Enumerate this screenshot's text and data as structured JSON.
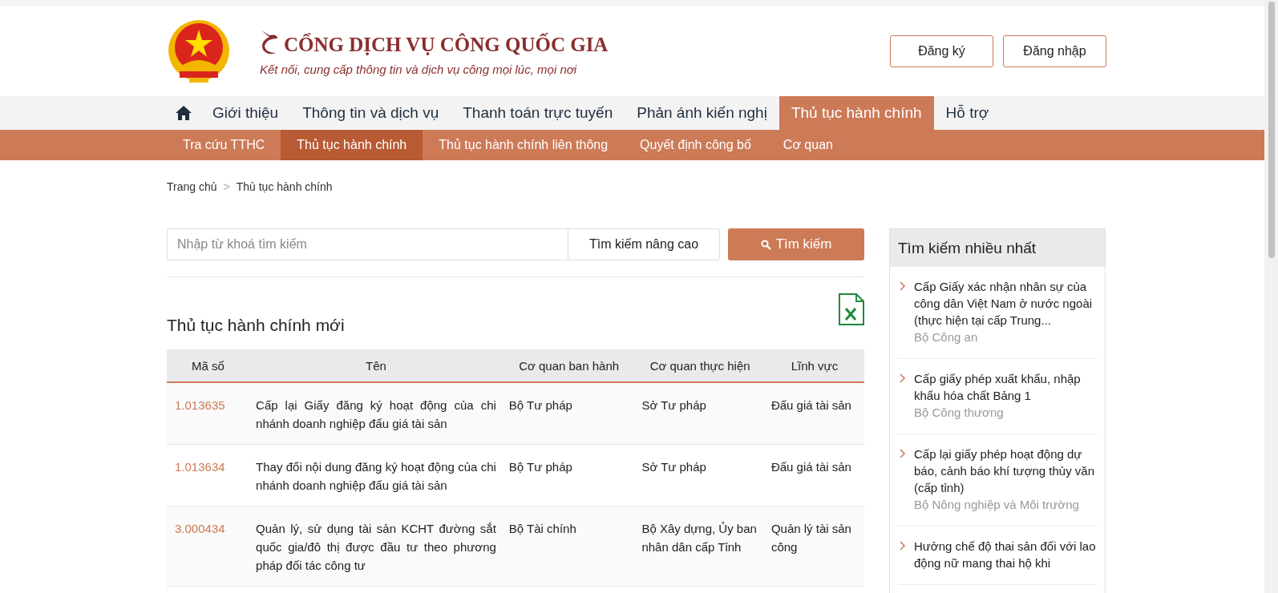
{
  "header": {
    "site_title": "CỔNG DỊCH VỤ CÔNG QUỐC GIA",
    "tagline": "Kết nối, cung cấp thông tin và dịch vụ công mọi lúc, mọi nơi",
    "buttons": [
      "Đăng ký",
      "Đăng nhập"
    ]
  },
  "main_nav": [
    {
      "label": "Giới thiệu",
      "selected": false
    },
    {
      "label": "Thông tin và dịch vụ",
      "selected": false
    },
    {
      "label": "Thanh toán trực tuyến",
      "selected": false
    },
    {
      "label": "Phản ánh kiến nghị",
      "selected": false
    },
    {
      "label": "Thủ tục hành chính",
      "selected": true
    },
    {
      "label": "Hỗ trợ",
      "selected": false
    }
  ],
  "sub_nav": [
    {
      "label": "Tra cứu TTHC",
      "selected": false
    },
    {
      "label": "Thủ tục hành chính",
      "selected": true
    },
    {
      "label": "Thủ tục hành chính liên thông",
      "selected": false
    },
    {
      "label": "Quyết định công bố",
      "selected": false
    },
    {
      "label": "Cơ quan",
      "selected": false
    }
  ],
  "breadcrumb": {
    "items": [
      "Trang chủ",
      "Thủ tục hành chính"
    ],
    "separator": ">"
  },
  "search": {
    "placeholder": "Nhập từ khoá tìm kiếm",
    "advanced": "Tìm kiếm nâng cao",
    "button": "Tìm kiếm"
  },
  "section_title": "Thủ tục hành chính mới",
  "table": {
    "columns": [
      "Mã số",
      "Tên",
      "Cơ quan ban hành",
      "Cơ quan thực hiện",
      "Lĩnh vực"
    ],
    "rows": [
      [
        "1.013635",
        "Cấp lại Giấy đăng ký hoạt động của chi nhánh doanh nghiệp đấu giá tài sản",
        "Bộ Tư pháp",
        "Sở Tư pháp",
        "Đấu giá tài sản"
      ],
      [
        "1.013634",
        "Thay đổi nội dung đăng ký hoạt động của chi nhánh doanh nghiệp đấu giá tài sản",
        "Bộ Tư pháp",
        "Sở Tư pháp",
        "Đấu giá tài sản"
      ],
      [
        "3.000434",
        "Quản lý, sử dụng tài sản KCHT đường sắt quốc gia/đô thị được đầu tư theo phương pháp đối tác công tư",
        "Bộ Tài chính",
        "Bộ Xây dựng, Ủy ban nhân dân cấp Tỉnh",
        "Quản lý tài sản công"
      ]
    ]
  },
  "sidebar": {
    "title": "Tìm kiếm nhiều nhất",
    "items": [
      {
        "title": "Cấp Giấy xác nhận nhân sự của công dân Việt Nam ở nước ngoài (thực hiện tại cấp Trung...",
        "agency": "Bộ Công an"
      },
      {
        "title": "Cấp giấy phép xuất khẩu, nhập khẩu hóa chất Bảng 1",
        "agency": "Bộ Công thương"
      },
      {
        "title": "Cấp lại giấy phép hoạt động dự báo, cảnh báo khí tượng thủy văn (cấp tỉnh)",
        "agency": "Bộ Nông nghiệp và Môi trường"
      },
      {
        "title": "Hưởng chế độ thai sản đối với lao động nữ mang thai hộ khi"
      }
    ]
  }
}
